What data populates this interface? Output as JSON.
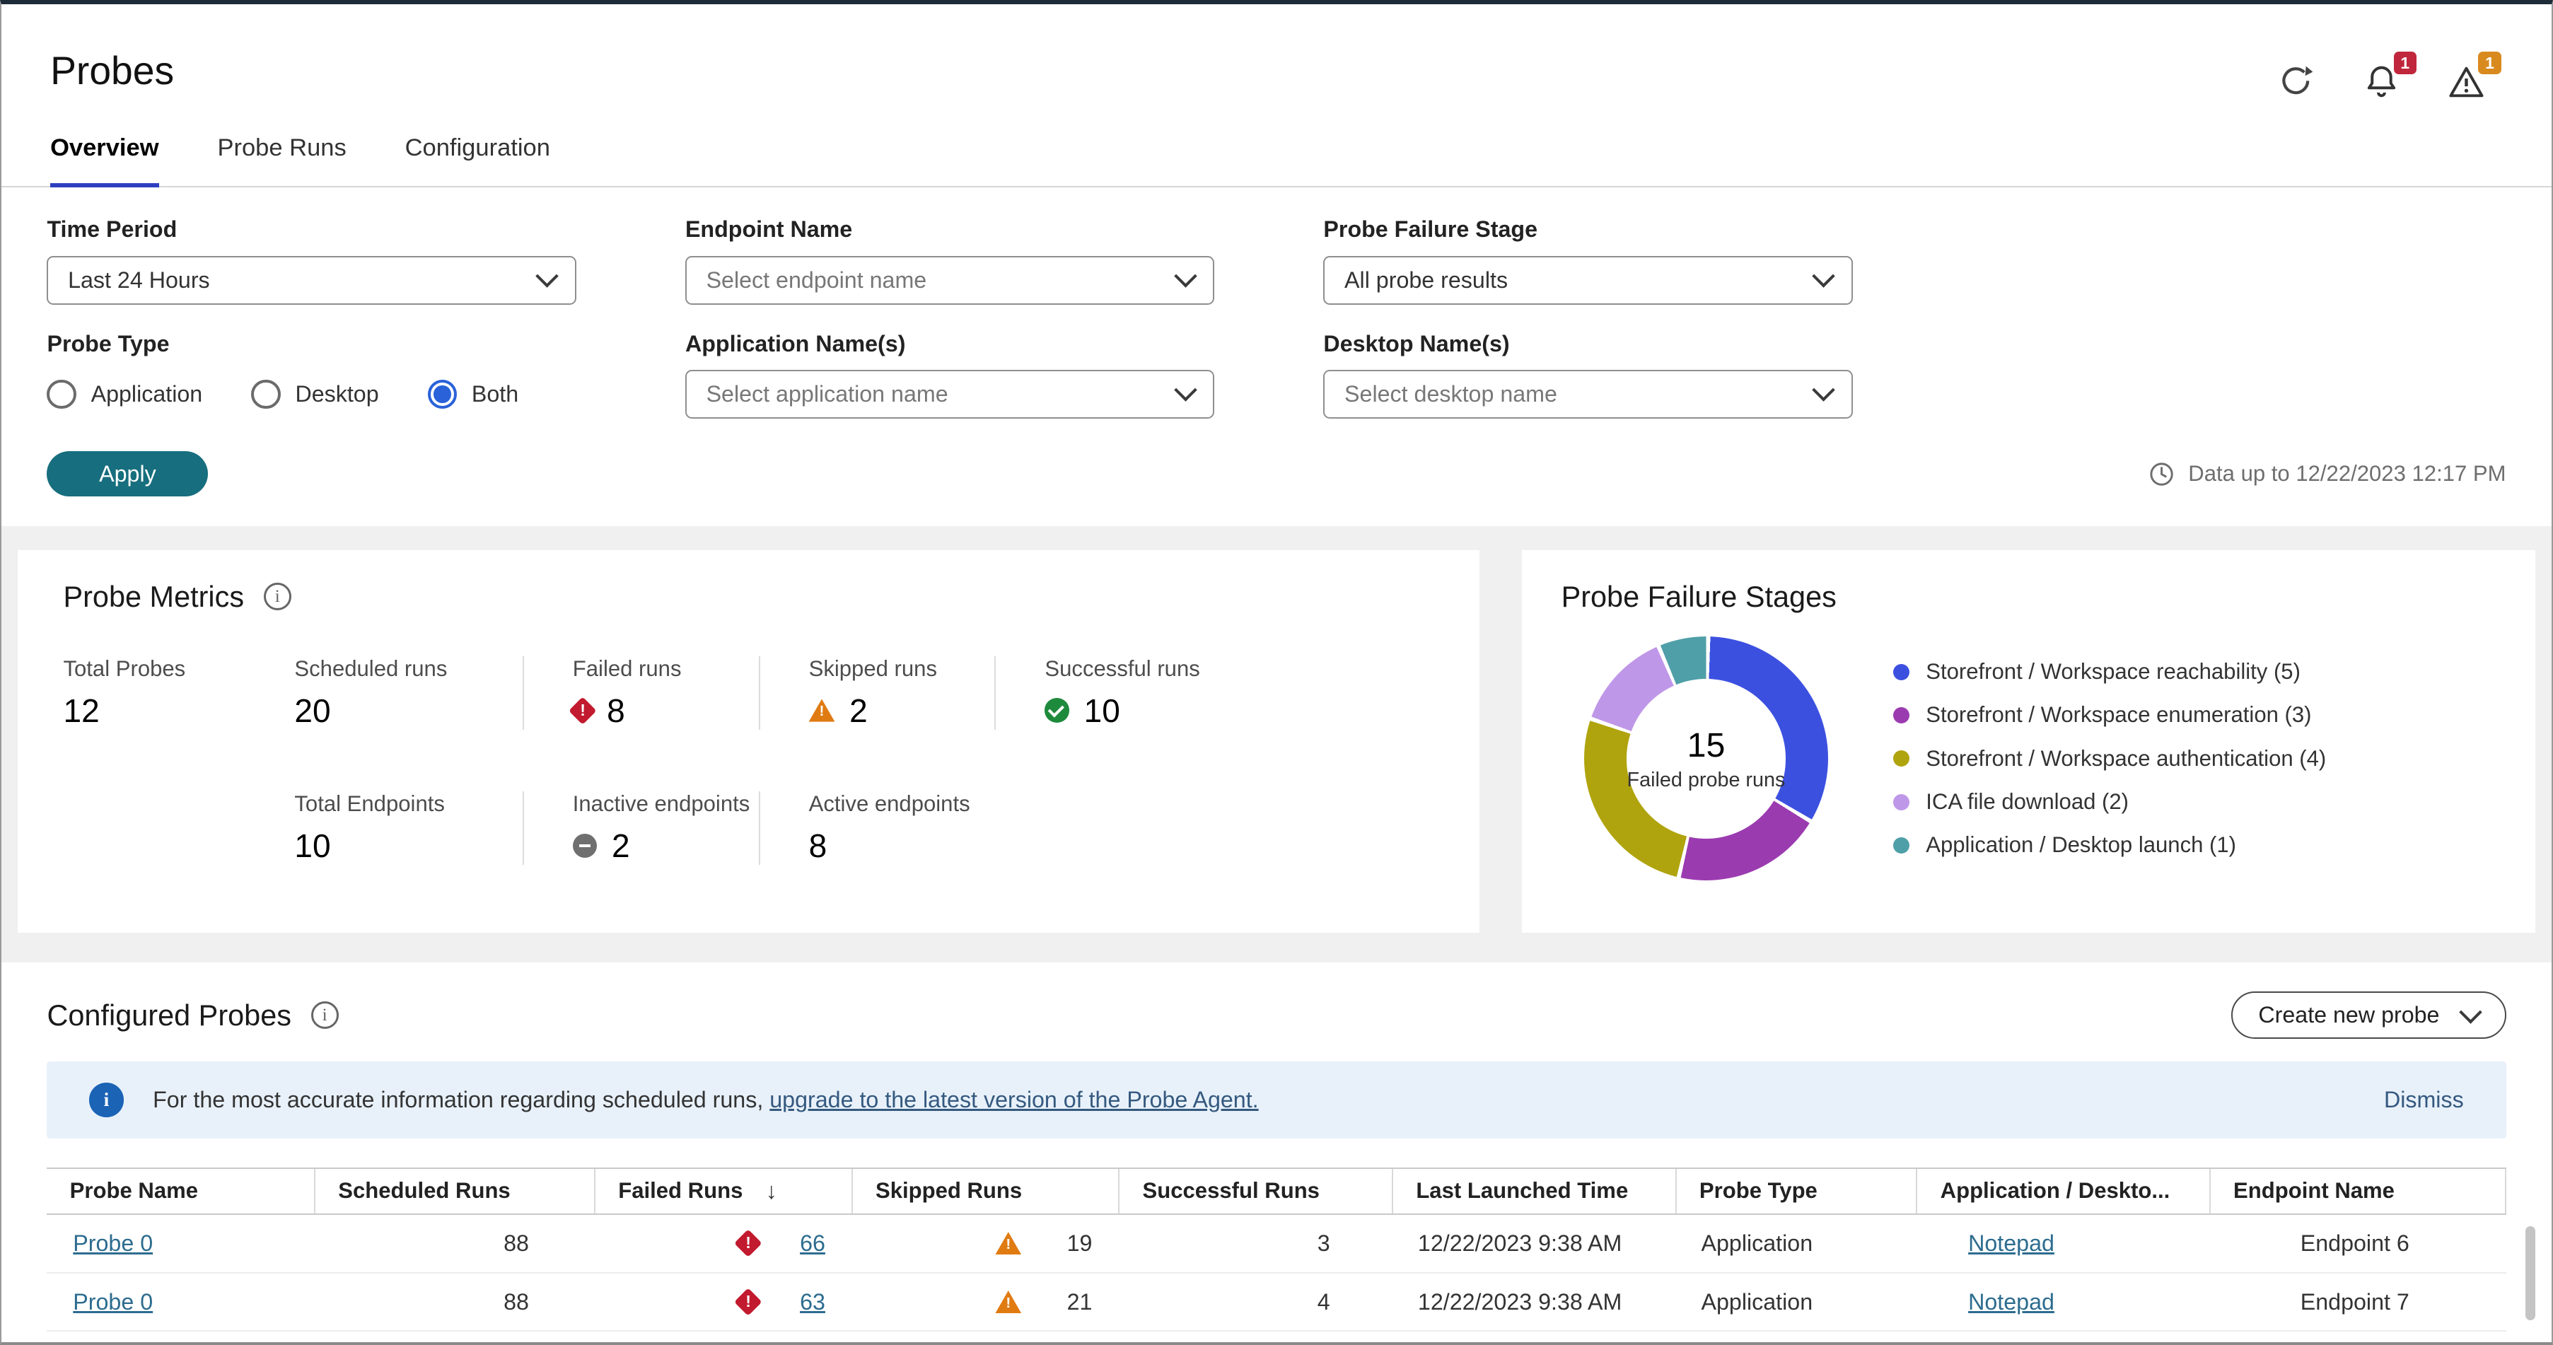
{
  "page": {
    "title": "Probes"
  },
  "header": {
    "alerts_badge": "1",
    "warnings_badge": "1"
  },
  "tabs": [
    {
      "label": "Overview",
      "active": true
    },
    {
      "label": "Probe Runs",
      "active": false
    },
    {
      "label": "Configuration",
      "active": false
    }
  ],
  "filters": {
    "time_period": {
      "label": "Time Period",
      "value": "Last 24 Hours"
    },
    "endpoint_name": {
      "label": "Endpoint Name",
      "placeholder": "Select endpoint name"
    },
    "probe_failure_stage": {
      "label": "Probe Failure Stage",
      "value": "All probe results"
    },
    "probe_type": {
      "label": "Probe Type",
      "options": [
        {
          "label": "Application",
          "selected": false
        },
        {
          "label": "Desktop",
          "selected": false
        },
        {
          "label": "Both",
          "selected": true
        }
      ]
    },
    "application_names": {
      "label": "Application Name(s)",
      "placeholder": "Select application name"
    },
    "desktop_names": {
      "label": "Desktop Name(s)",
      "placeholder": "Select desktop name"
    },
    "apply_label": "Apply",
    "data_up_to": "Data up to 12/22/2023 12:17 PM"
  },
  "probe_metrics": {
    "title": "Probe Metrics",
    "row1": [
      {
        "label": "Total Probes",
        "value": "12"
      },
      {
        "label": "Scheduled runs",
        "value": "20"
      },
      {
        "label": "Failed runs",
        "value": "8",
        "icon": "failed"
      },
      {
        "label": "Skipped runs",
        "value": "2",
        "icon": "skipped"
      },
      {
        "label": "Successful runs",
        "value": "10",
        "icon": "success"
      }
    ],
    "row2": [
      {
        "label": "Total Endpoints",
        "value": "10"
      },
      {
        "label": "Inactive endpoints",
        "value": "2",
        "icon": "inactive"
      },
      {
        "label": "Active endpoints",
        "value": "8"
      }
    ]
  },
  "chart_data": {
    "type": "pie",
    "title": "Probe Failure Stages",
    "center_value": "15",
    "center_label": "Failed probe runs",
    "legend_position": "right",
    "slices": [
      {
        "label": "Storefront / Workspace reachability",
        "value": 5,
        "color": "#3c50e0"
      },
      {
        "label": "Storefront / Workspace enumeration",
        "value": 3,
        "color": "#9b3bb0"
      },
      {
        "label": "Storefront / Workspace authentication",
        "value": 4,
        "color": "#b0a40e"
      },
      {
        "label": "ICA file download",
        "value": 2,
        "color": "#bf97e8"
      },
      {
        "label": "Application / Desktop launch",
        "value": 1,
        "color": "#4f9fa8"
      }
    ]
  },
  "configured_probes": {
    "title": "Configured Probes",
    "create_button_label": "Create new probe",
    "banner": {
      "text": "For the most accurate information regarding scheduled runs,",
      "link_text": "upgrade to the latest version of the Probe Agent.",
      "dismiss_label": "Dismiss"
    },
    "table": {
      "columns": [
        "Probe Name",
        "Scheduled Runs",
        "Failed Runs",
        "Skipped Runs",
        "Successful Runs",
        "Last Launched Time",
        "Probe Type",
        "Application / Deskto...",
        "Endpoint Name"
      ],
      "sorted_column": "Failed Runs",
      "sort_direction": "desc",
      "rows": [
        {
          "probe_name": "Probe 0",
          "scheduled_runs": "88",
          "failed_runs": "66",
          "skipped_runs": "19",
          "successful_runs": "3",
          "last_launched_time": "12/22/2023 9:38 AM",
          "probe_type": "Application",
          "application_desktop": "Notepad",
          "endpoint_name": "Endpoint 6"
        },
        {
          "probe_name": "Probe 0",
          "scheduled_runs": "88",
          "failed_runs": "63",
          "skipped_runs": "21",
          "successful_runs": "4",
          "last_launched_time": "12/22/2023 9:38 AM",
          "probe_type": "Application",
          "application_desktop": "Notepad",
          "endpoint_name": "Endpoint 7"
        }
      ]
    }
  },
  "colors": {
    "apply_button": "#176e7e",
    "active_tab_underline": "#2d3fc0",
    "table_link": "#2d6c8f",
    "banner_background": "#e8f1fa",
    "failed_icon": "#c21a2e",
    "skipped_icon": "#e07b12",
    "success_icon": "#1e8a3c",
    "inactive_icon": "#6f6f6f",
    "alert_badge": "#c0273d",
    "warning_badge": "#d98a1f"
  },
  "icons": {
    "header": [
      "refresh-icon",
      "alerts-icon",
      "warning-icon"
    ],
    "failed": "diamond-exclamation",
    "skipped": "triangle-exclamation",
    "success": "circle-check",
    "inactive": "circle-minus",
    "info": "circle-i",
    "clock": "clock",
    "sort": "arrow-down",
    "dropdown": "chevron-down"
  }
}
